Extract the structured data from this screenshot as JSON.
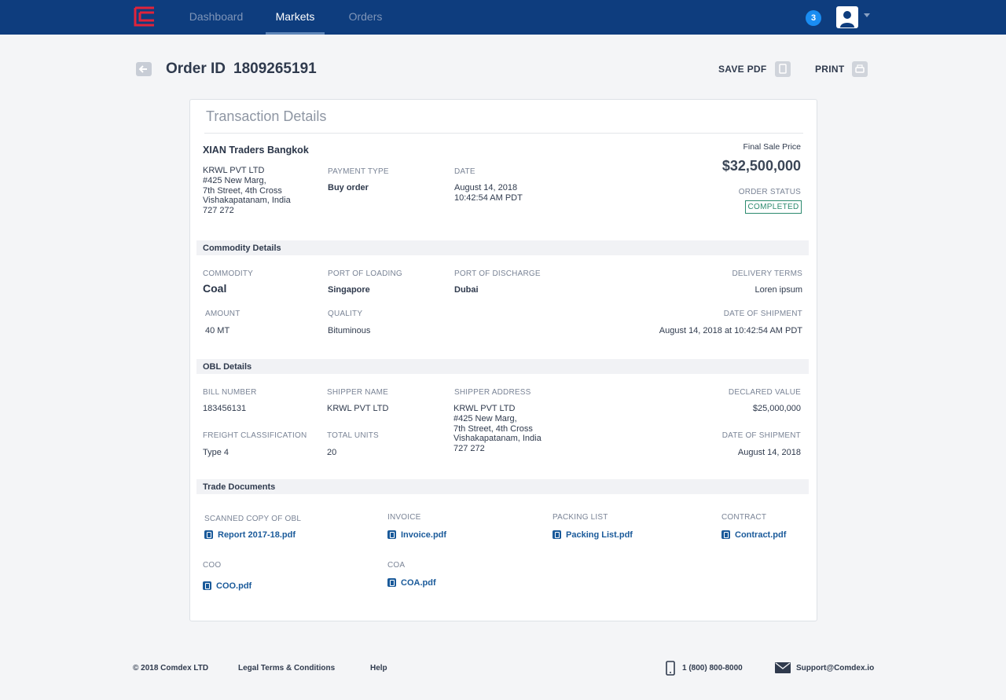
{
  "nav": {
    "tabs": [
      "Dashboard",
      "Markets",
      "Orders"
    ],
    "active": "Markets",
    "notification_count": "3"
  },
  "page": {
    "title_label": "Order ID",
    "order_id": "1809265191",
    "save_pdf": "SAVE PDF",
    "print": "PRINT"
  },
  "transaction": {
    "card_title": "Transaction Details",
    "company": "XIAN Traders Bangkok",
    "address": "KRWL PVT LTD\n#425 New Marg,\n7th Street, 4th Cross\nVishakapatanam, India\n727 272",
    "payment_type_label": "PAYMENT TYPE",
    "payment_type": "Buy order",
    "date_label": "DATE",
    "date": "August 14, 2018\n10:42:54 AM PDT",
    "final_price_label": "Final Sale Price",
    "final_price": "$32,500,000",
    "order_status_label": "ORDER STATUS",
    "order_status": "COMPLETED"
  },
  "commodity": {
    "section_title": "Commodity Details",
    "commodity_label": "COMMODITY",
    "commodity": "Coal",
    "port_loading_label": "PORT OF LOADING",
    "port_loading": "Singapore",
    "port_discharge_label": "PORT OF DISCHARGE",
    "port_discharge": "Dubai",
    "delivery_terms_label": "DELIVERY TERMS",
    "delivery_terms": "Loren ipsum",
    "amount_label": "AMOUNT",
    "amount": "40 MT",
    "quality_label": "QUALITY",
    "quality": "Bituminous",
    "shipment_date_label": "DATE OF SHIPMENT",
    "shipment_date": "August 14, 2018 at 10:42:54 AM PDT"
  },
  "obl": {
    "section_title": "OBL Details",
    "bill_number_label": "BILL NUMBER",
    "bill_number": "183456131",
    "shipper_name_label": "SHIPPER NAME",
    "shipper_name": "KRWL PVT LTD",
    "shipper_address_label": "SHIPPER ADDRESS",
    "shipper_address": "KRWL PVT LTD\n#425 New Marg,\n7th Street, 4th Cross\nVishakapatanam, India\n727 272",
    "declared_value_label": "DECLARED VALUE",
    "declared_value": "$25,000,000",
    "freight_label": "FREIGHT CLASSIFICATION",
    "freight": "Type 4",
    "total_units_label": "TOTAL UNITS",
    "total_units": "20",
    "shipment_date_label": "DATE OF SHIPMENT",
    "shipment_date": "August 14, 2018"
  },
  "documents": {
    "section_title": "Trade Documents",
    "scanned_obl_label": "SCANNED COPY OF OBL",
    "scanned_obl": "Report 2017-18.pdf",
    "invoice_label": "INVOICE",
    "invoice": "Invoice.pdf",
    "packing_label": "PACKING LIST",
    "packing": "Packing List.pdf",
    "contract_label": "CONTRACT",
    "contract": "Contract.pdf",
    "coo_label": "COO",
    "coo": "COO.pdf",
    "coa_label": "COA",
    "coa": "COA.pdf"
  },
  "footer": {
    "copyright": "© 2018 Comdex LTD",
    "legal": "Legal Terms & Conditions",
    "help": "Help",
    "phone": "1 (800) 800-8000",
    "email": "Support@Comdex.io"
  },
  "colors": {
    "topbar": "#0e3d7e",
    "accent": "#1a8df2",
    "status": "#2b8a6e",
    "link": "#1a5a9a",
    "logo": "#e0233a"
  },
  "icons": [
    "comdex-logo",
    "user-avatar-icon",
    "back-arrow-icon",
    "copy-icon",
    "printer-icon",
    "file-icon",
    "phone-icon",
    "mail-icon"
  ]
}
